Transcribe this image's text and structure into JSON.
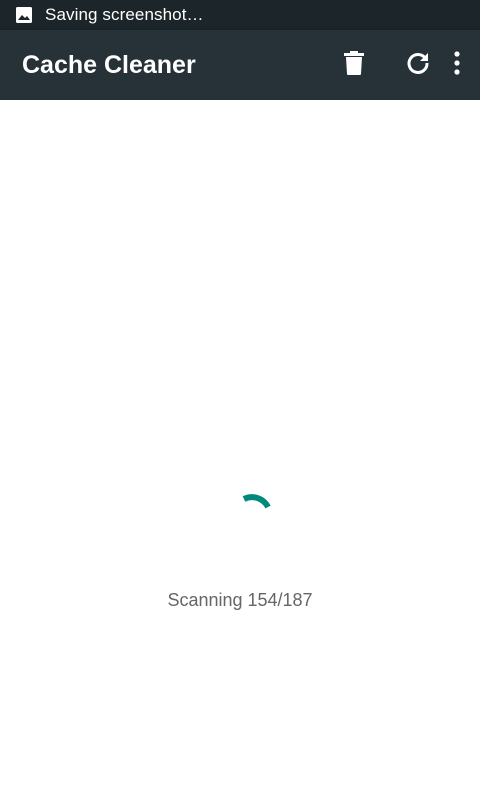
{
  "status_bar": {
    "notification": "Saving screenshot…",
    "icon": "image-icon"
  },
  "app_bar": {
    "title": "Cache Cleaner",
    "actions": [
      {
        "name": "delete",
        "icon": "trash-icon"
      },
      {
        "name": "refresh",
        "icon": "refresh-icon"
      },
      {
        "name": "more",
        "icon": "more-vert-icon"
      }
    ]
  },
  "main": {
    "scan_status": "Scanning 154/187",
    "progress": {
      "current": 154,
      "total": 187
    }
  },
  "colors": {
    "status_bar": "#1c2529",
    "app_bar": "#263238",
    "accent": "#00897b",
    "body_text": "#666666"
  }
}
